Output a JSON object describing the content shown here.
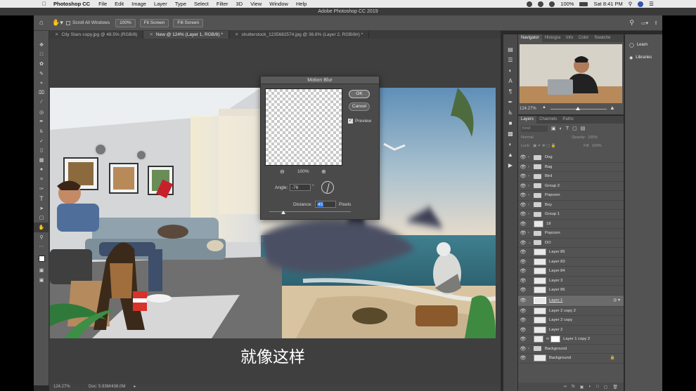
{
  "menubar": {
    "app_name": "Photoshop CC",
    "items": [
      "File",
      "Edit",
      "Image",
      "Layer",
      "Type",
      "Select",
      "Filter",
      "3D",
      "View",
      "Window",
      "Help"
    ],
    "battery": "100%",
    "clock": "Sat 8:41 PM"
  },
  "window_title": "Adobe Photoshop CC 2019",
  "options_bar": {
    "scroll_all_windows": "Scroll All Windows",
    "zoom_btn": "100%",
    "fit_screen": "Fit Screen",
    "fill_screen": "Fill Screen"
  },
  "tabs": [
    {
      "label": "City Stars copy.jpg @ 48.5% (RGB/8)",
      "active": false
    },
    {
      "label": "New @ 124% (Layer 1, RGB/8) *",
      "active": true
    },
    {
      "label": "shutterstock_1235682574.jpg @ 36.8% (Layer 2, RGB/8#) *",
      "active": false
    }
  ],
  "dialog": {
    "title": "Motion Blur",
    "ok": "OK",
    "cancel": "Cancel",
    "preview_label": "Preview",
    "preview_checked": true,
    "zoom": "100%",
    "angle_label": "Angle:",
    "angle_value": "-76",
    "angle_unit": "°",
    "distance_label": "Distance:",
    "distance_value": "45",
    "distance_unit": "Pixels"
  },
  "subtitle": "就像这样",
  "statusbar": {
    "zoom": "124.27%",
    "doc": "Doc: 5.93M/438.0M"
  },
  "navigator": {
    "tabs": [
      "Navigator",
      "Histogra",
      "Info",
      "Color",
      "Swatche"
    ],
    "zoom": "124.27%"
  },
  "layers_panel": {
    "tabs": [
      "Layers",
      "Channels",
      "Paths"
    ],
    "kind_placeholder": "Kind",
    "blend_mode": "Normal",
    "opacity_label": "Opacity:",
    "opacity_value": "100%",
    "lock_label": "Lock:",
    "fill_label": "Fill:",
    "fill_value": "100%",
    "rows": [
      {
        "name": "Dog",
        "type": "group"
      },
      {
        "name": "Bag",
        "type": "group"
      },
      {
        "name": "Bird",
        "type": "group"
      },
      {
        "name": "Group 2",
        "type": "group"
      },
      {
        "name": "Popcorn",
        "type": "group"
      },
      {
        "name": "Boy",
        "type": "group"
      },
      {
        "name": "Group 1",
        "type": "group"
      },
      {
        "name": "18",
        "type": "smart"
      },
      {
        "name": "Popcorn",
        "type": "group"
      },
      {
        "name": "DO",
        "type": "group-open"
      },
      {
        "name": "Layer 85",
        "type": "layer-clip"
      },
      {
        "name": "Layer 83",
        "type": "layer-clip"
      },
      {
        "name": "Layer 84",
        "type": "layer-clip"
      },
      {
        "name": "Layer 3",
        "type": "layer-clip"
      },
      {
        "name": "Layer 86",
        "type": "layer-clip"
      },
      {
        "name": "Layer 1",
        "type": "selected"
      },
      {
        "name": "Layer 2 copy 2",
        "type": "layer"
      },
      {
        "name": "Layer 2 copy",
        "type": "layer"
      },
      {
        "name": "Layer 2",
        "type": "layer"
      },
      {
        "name": "Layer 1 copy 2",
        "type": "masked"
      },
      {
        "name": "Background",
        "type": "group"
      },
      {
        "name": "Background",
        "type": "background"
      }
    ]
  },
  "side_panel": {
    "learn": "Learn",
    "libraries": "Libraries"
  },
  "tool_icons": [
    "move-icon",
    "marquee-icon",
    "lasso-icon",
    "quick-select-icon",
    "crop-icon",
    "frame-icon",
    "eyedropper-icon",
    "healing-icon",
    "brush-icon",
    "stamp-icon",
    "history-brush-icon",
    "eraser-icon",
    "gradient-icon",
    "blur-icon",
    "dodge-icon",
    "pen-icon",
    "type-icon",
    "path-select-icon",
    "rectangle-icon",
    "hand-icon",
    "zoom-icon",
    "more-icon",
    "colors-icon",
    "quickmask-icon",
    "screenmode-icon"
  ]
}
